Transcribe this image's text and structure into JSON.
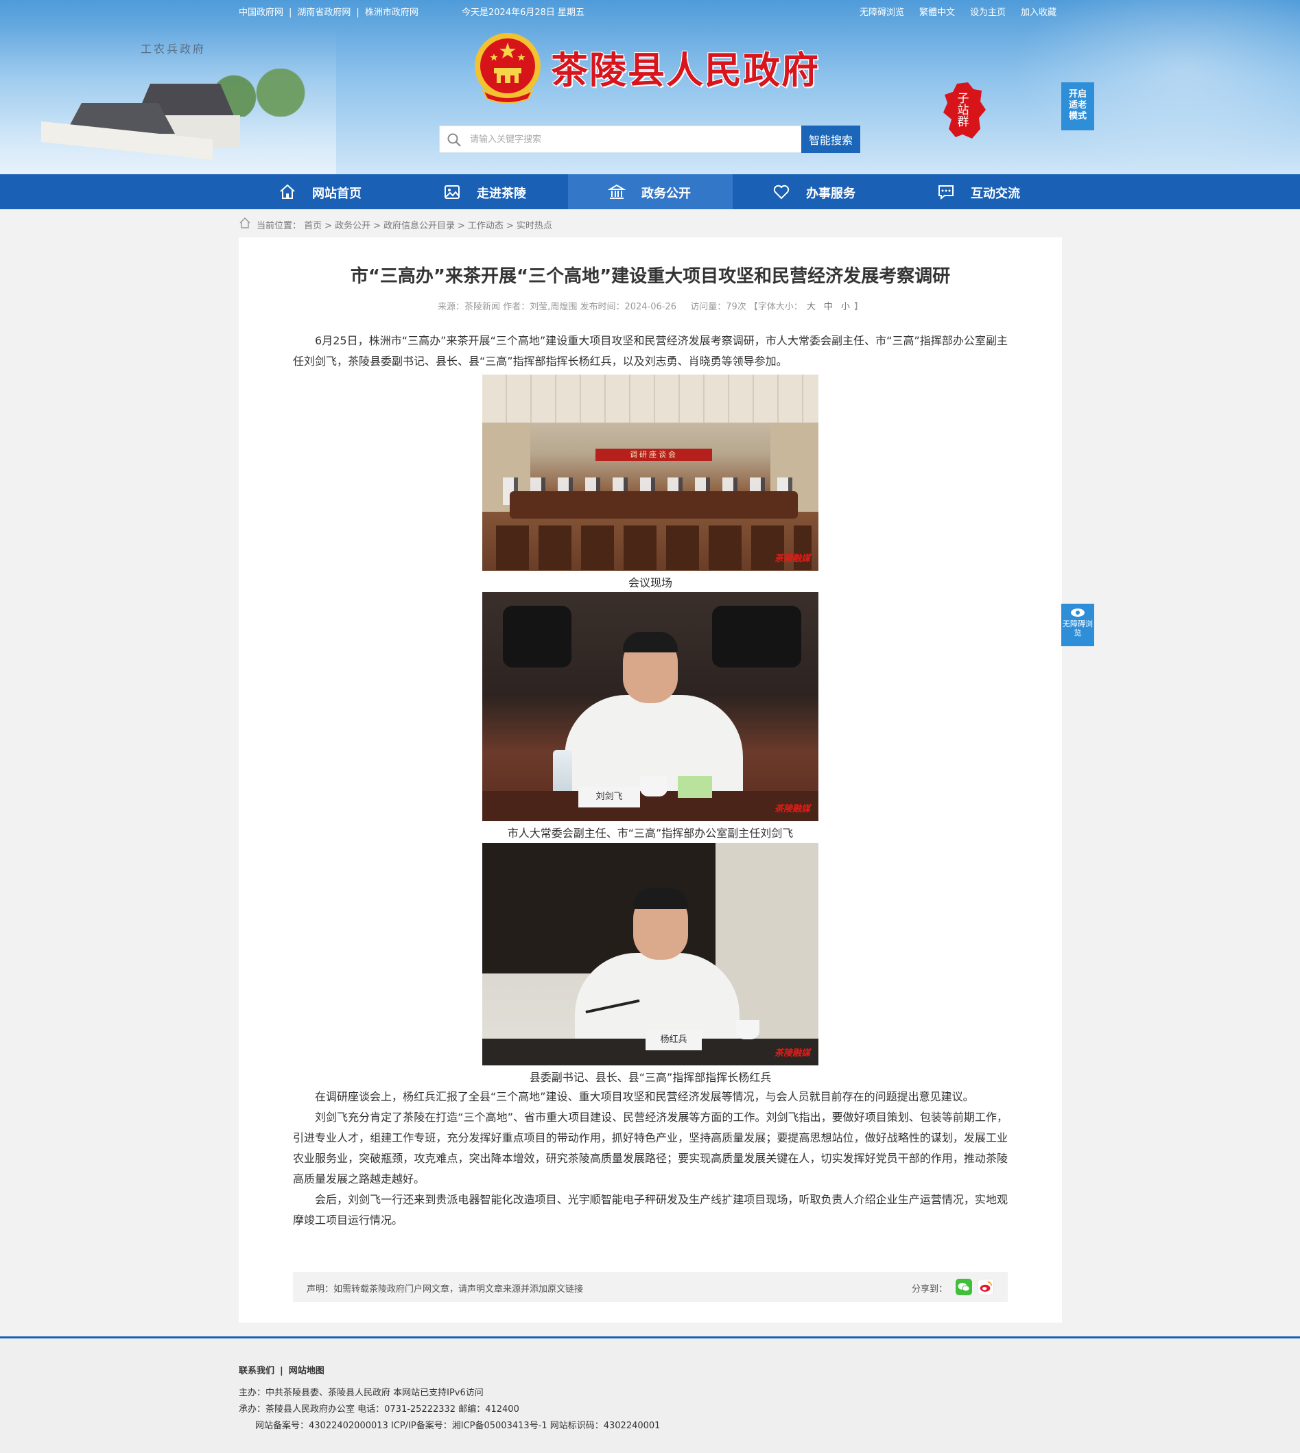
{
  "topbar": {
    "links": [
      "中国政府网",
      "湖南省政府网",
      "株洲市政府网"
    ],
    "date": "今天是2024年6月28日 星期五",
    "right_links": [
      "无障碍浏览",
      "繁體中文",
      "设为主页",
      "加入收藏"
    ]
  },
  "header": {
    "site_title": "茶陵县人民政府",
    "scene_caption": "工农兵政府",
    "subsite_label": "子站群",
    "elder_mode": [
      "开启",
      "适老",
      "模式"
    ]
  },
  "search": {
    "placeholder": "请输入关键字搜索",
    "value": "",
    "button_label": "智能搜索"
  },
  "nav": {
    "items": [
      {
        "label": "网站首页",
        "icon": "home-icon"
      },
      {
        "label": "走进茶陵",
        "icon": "picture-icon"
      },
      {
        "label": "政务公开",
        "icon": "government-building-icon"
      },
      {
        "label": "办事服务",
        "icon": "heart-icon"
      },
      {
        "label": "互动交流",
        "icon": "chat-icon"
      }
    ],
    "active_index": 2
  },
  "breadcrumb": {
    "prefix": "当前位置：",
    "items": [
      "首页",
      "政务公开",
      "政府信息公开目录",
      "工作动态",
      "实时热点"
    ],
    "separator": ">"
  },
  "article": {
    "title": "市“三高办”来茶开展“三个高地”建设重大项目攻坚和民营经济发展考察调研",
    "meta": {
      "source": "来源：茶陵新闻",
      "author": "作者：刘莹,周煌围",
      "publish_time": "发布时间：2024-06-26",
      "views": "访问量：79次",
      "font_size_label": "【字体大小：",
      "font_sizes": [
        "大",
        "中",
        "小"
      ],
      "font_size_end": "】"
    },
    "intro": "6月25日，株洲市“三高办”来茶开展“三个高地”建设重大项目攻坚和民营经济发展考察调研，市人大常委会副主任、市“三高”指挥部办公室副主任刘剑飞，茶陵县委副书记、县长、县“三高”指挥部指挥长杨红兵，以及刘志勇、肖晓勇等领导参加。",
    "figures": [
      {
        "caption": "会议现场",
        "banner_text": "调研座谈会",
        "watermark": "茶陵融媒"
      },
      {
        "caption": "市人大常委会副主任、市“三高”指挥部办公室副主任刘剑飞",
        "nameplate": "刘剑飞",
        "watermark": "茶陵融媒"
      },
      {
        "caption": "县委副书记、县长、县“三高”指挥部指挥长杨红兵",
        "nameplate": "杨红兵",
        "watermark": "茶陵融媒"
      }
    ],
    "paragraphs": [
      "在调研座谈会上，杨红兵汇报了全县“三个高地”建设、重大项目攻坚和民营经济发展等情况，与会人员就目前存在的问题提出意见建议。",
      "刘剑飞充分肯定了茶陵在打造“三个高地”、省市重大项目建设、民营经济发展等方面的工作。刘剑飞指出，要做好项目策划、包装等前期工作，引进专业人才，组建工作专班，充分发挥好重点项目的带动作用，抓好特色产业，坚持高质量发展；要提高思想站位，做好战略性的谋划，发展工业农业服务业，突破瓶颈，攻克难点，突出降本增效，研究茶陵高质量发展路径；要实现高质量发展关键在人，切实发挥好党员干部的作用，推动茶陵高质量发展之路越走越好。",
      "会后，刘剑飞一行还来到贵派电器智能化改造项目、光宇顺智能电子秤研发及生产线扩建项目现场，听取负责人介绍企业生产运营情况，实地观摩竣工项目运行情况。"
    ],
    "statement": "声明：如需转载茶陵政府门户网文章，请声明文章来源并添加原文链接",
    "share_label": "分享到："
  },
  "accessibility_float": "无障碍浏览",
  "footer": {
    "links": [
      "联系我们",
      "网站地图"
    ],
    "host": "主办：中共茶陵县委、茶陵县人民政府 本网站已支持IPv6访问",
    "organizer": "承办：茶陵县人民政府办公室 电话：0731-25222332 邮编：412400",
    "records": "网站备案号：43022402000013 ICP/IP备案号：湘ICP备05003413号-1 网站标识码：4302240001"
  },
  "colors": {
    "nav_bg": "#1a60b5",
    "nav_active": "#3377c9",
    "title_red": "#d8141c",
    "search_button": "#1b66b8",
    "float_blue": "#2e8ed8"
  }
}
